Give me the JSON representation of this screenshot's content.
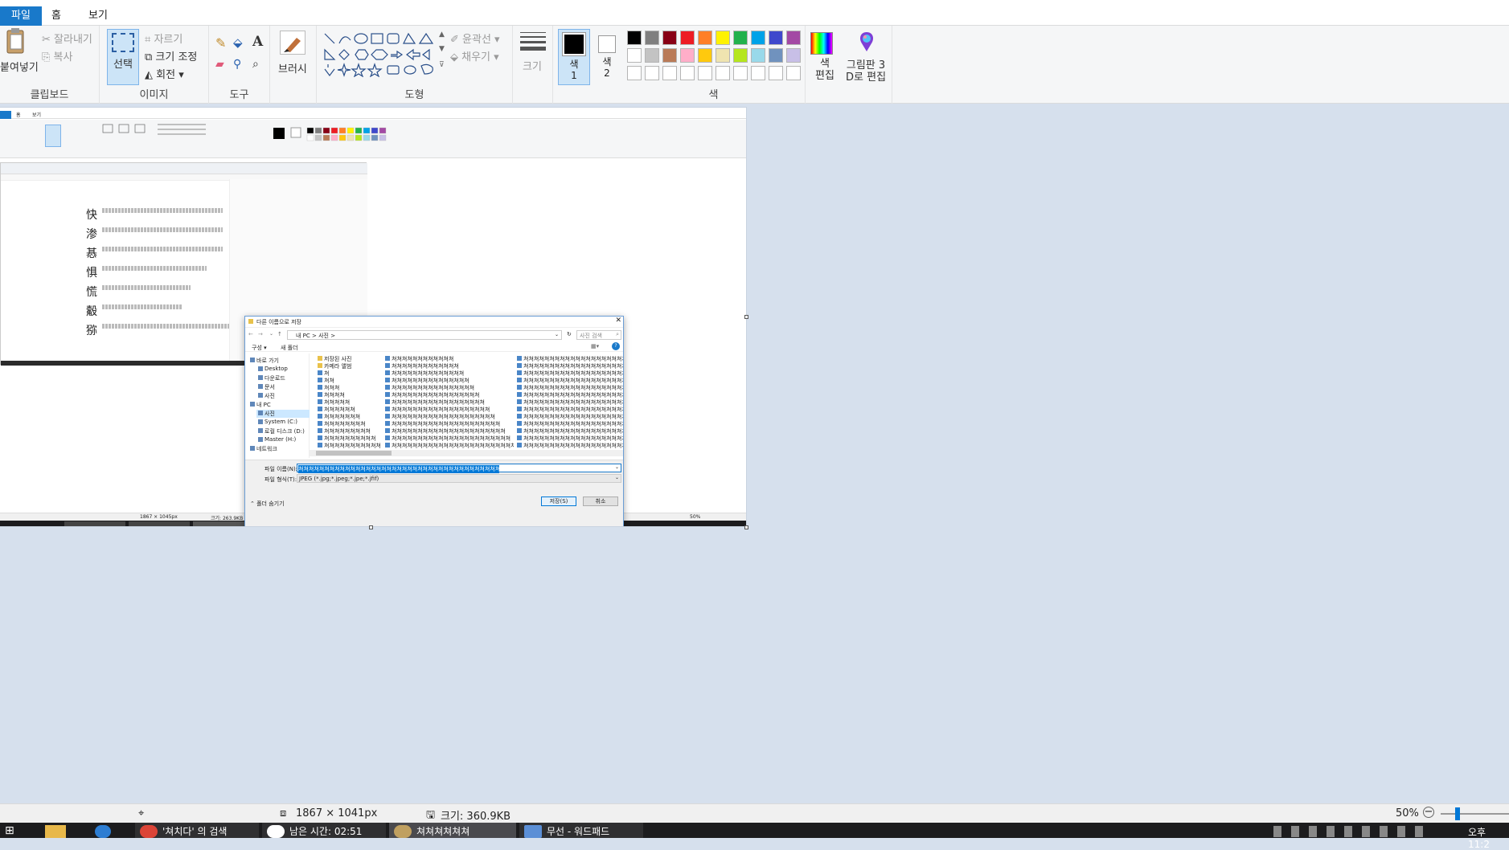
{
  "tabs": {
    "file": "파일",
    "home": "홈",
    "view": "보기"
  },
  "ribbon": {
    "clipboard": {
      "paste": "붙여넣기",
      "cut": "잘라내기",
      "copy": "복사",
      "label": "클립보드"
    },
    "image": {
      "select": "선택",
      "crop": "자르기",
      "resize": "크기 조정",
      "rotate": "회전",
      "label": "이미지"
    },
    "tools": {
      "label": "도구"
    },
    "brushes": {
      "label": "브러시"
    },
    "shapes": {
      "outline": "윤곽선",
      "fill": "채우기",
      "label": "도형"
    },
    "size": {
      "label": "크기"
    },
    "color1": {
      "label": "색\n1"
    },
    "color2": {
      "label": "색\n2"
    },
    "colors": {
      "label": "색",
      "row1": [
        "#000000",
        "#7f7f7f",
        "#880015",
        "#ed1c24",
        "#ff7f27",
        "#fff200",
        "#22b14c",
        "#00a2e8",
        "#3f48cc",
        "#a349a4"
      ],
      "row2": [
        "#ffffff",
        "#c3c3c3",
        "#b97a57",
        "#ffaec9",
        "#ffc90e",
        "#efe4b0",
        "#b5e61d",
        "#99d9ea",
        "#7092be",
        "#c8bfe7"
      ]
    },
    "edit_colors": "색\n편집",
    "paint3d": "그림판 3\nD로 편집"
  },
  "dialog": {
    "title": "다른 이름으로 저장",
    "path": "내 PC  >  사진  >",
    "search_placeholder": "사진 검색",
    "organize": "구성 ▾",
    "new_folder": "새 폴더",
    "nav": [
      "바로 가기",
      "Desktop",
      "다운로드",
      "문서",
      "사진",
      "내 PC",
      "사진",
      "System (C:)",
      "로컬 디스크 (D:)",
      "Master (H:)",
      "네트워크"
    ],
    "col1": [
      "저장된 사진",
      "카메라 앨범",
      "쳐",
      "쳐쳐",
      "쳐쳐쳐",
      "쳐쳐쳐쳐",
      "쳐쳐쳐쳐쳐",
      "쳐쳐쳐쳐쳐쳐",
      "쳐쳐쳐쳐쳐쳐쳐",
      "쳐쳐쳐쳐쳐쳐쳐쳐",
      "쳐쳐쳐쳐쳐쳐쳐쳐쳐",
      "쳐쳐쳐쳐쳐쳐쳐쳐쳐쳐",
      "쳐쳐쳐쳐쳐쳐쳐쳐쳐쳐쳐"
    ],
    "col2": [
      "쳐쳐쳐쳐쳐쳐쳐쳐쳐쳐쳐쳐",
      "쳐쳐쳐쳐쳐쳐쳐쳐쳐쳐쳐쳐쳐",
      "쳐쳐쳐쳐쳐쳐쳐쳐쳐쳐쳐쳐쳐쳐",
      "쳐쳐쳐쳐쳐쳐쳐쳐쳐쳐쳐쳐쳐쳐쳐",
      "쳐쳐쳐쳐쳐쳐쳐쳐쳐쳐쳐쳐쳐쳐쳐쳐",
      "쳐쳐쳐쳐쳐쳐쳐쳐쳐쳐쳐쳐쳐쳐쳐쳐쳐",
      "쳐쳐쳐쳐쳐쳐쳐쳐쳐쳐쳐쳐쳐쳐쳐쳐쳐쳐",
      "쳐쳐쳐쳐쳐쳐쳐쳐쳐쳐쳐쳐쳐쳐쳐쳐쳐쳐쳐",
      "쳐쳐쳐쳐쳐쳐쳐쳐쳐쳐쳐쳐쳐쳐쳐쳐쳐쳐쳐쳐",
      "쳐쳐쳐쳐쳐쳐쳐쳐쳐쳐쳐쳐쳐쳐쳐쳐쳐쳐쳐쳐쳐",
      "쳐쳐쳐쳐쳐쳐쳐쳐쳐쳐쳐쳐쳐쳐쳐쳐쳐쳐쳐쳐쳐쳐",
      "쳐쳐쳐쳐쳐쳐쳐쳐쳐쳐쳐쳐쳐쳐쳐쳐쳐쳐쳐쳐쳐쳐쳐",
      "쳐쳐쳐쳐쳐쳐쳐쳐쳐쳐쳐쳐쳐쳐쳐쳐쳐쳐쳐쳐쳐쳐쳐쳐"
    ],
    "col3": [
      "쳐쳐쳐쳐쳐쳐쳐쳐쳐쳐쳐쳐쳐쳐쳐쳐쳐쳐쳐쳐쳐쳐쳐",
      "쳐쳐쳐쳐쳐쳐쳐쳐쳐쳐쳐쳐쳐쳐쳐쳐쳐쳐쳐쳐쳐쳐쳐",
      "쳐쳐쳐쳐쳐쳐쳐쳐쳐쳐쳐쳐쳐쳐쳐쳐쳐쳐쳐쳐쳐쳐쳐",
      "쳐쳐쳐쳐쳐쳐쳐쳐쳐쳐쳐쳐쳐쳐쳐쳐쳐쳐쳐쳐쳐쳐쳐",
      "쳐쳐쳐쳐쳐쳐쳐쳐쳐쳐쳐쳐쳐쳐쳐쳐쳐쳐쳐쳐쳐쳐쳐",
      "쳐쳐쳐쳐쳐쳐쳐쳐쳐쳐쳐쳐쳐쳐쳐쳐쳐쳐쳐쳐쳐쳐쳐",
      "쳐쳐쳐쳐쳐쳐쳐쳐쳐쳐쳐쳐쳐쳐쳐쳐쳐쳐쳐쳐쳐쳐쳐",
      "쳐쳐쳐쳐쳐쳐쳐쳐쳐쳐쳐쳐쳐쳐쳐쳐쳐쳐쳐쳐쳐쳐쳐",
      "쳐쳐쳐쳐쳐쳐쳐쳐쳐쳐쳐쳐쳐쳐쳐쳐쳐쳐쳐쳐쳐쳐쳐",
      "쳐쳐쳐쳐쳐쳐쳐쳐쳐쳐쳐쳐쳐쳐쳐쳐쳐쳐쳐쳐쳐쳐쳐",
      "쳐쳐쳐쳐쳐쳐쳐쳐쳐쳐쳐쳐쳐쳐쳐쳐쳐쳐쳐쳐쳐쳐쳐",
      "쳐쳐쳐쳐쳐쳐쳐쳐쳐쳐쳐쳐쳐쳐쳐쳐쳐쳐쳐쳐쳐쳐쳐",
      "쳐쳐쳐쳐쳐쳐쳐쳐쳐쳐쳐쳐쳐쳐쳐쳐쳐쳐쳐쳐쳐쳐쳐"
    ],
    "filename_label": "파일 이름(N):",
    "filename_value": "쳐쳐쳐쳐쳐쳐쳐쳐쳐쳐쳐쳐쳐쳐쳐쳐쳐쳐쳐쳐쳐쳐쳐쳐쳐쳐쳐쳐쳐쳐쳐쳐쳐쳐쳐쳐쳐쳐쳐쳐쳐쳐쳐쳐쳐쳐",
    "filetype_label": "파일 형식(T):",
    "filetype_value": "JPEG (*.jpg;*.jpeg;*.jpe;*.jfif)",
    "hide_folders": "⌃ 폴더 숨기기",
    "save": "저장(S)",
    "cancel": "취소"
  },
  "inner_canvas": {
    "tab_view": "보기",
    "status_dims": "1867 × 1045px",
    "status_size": "크기: 263.9KB",
    "zoom": "50%"
  },
  "status": {
    "dimensions": "1867 × 1041px",
    "size": "크기: 360.9KB",
    "zoom": "50%"
  },
  "taskbar": {
    "items": [
      "'쳐치다' 의 검색",
      "남은 시간: 02:51",
      "쳐쳐쳐쳐쳐쳐",
      "무선 - 워드패드"
    ],
    "clock": "오후 11:2"
  }
}
